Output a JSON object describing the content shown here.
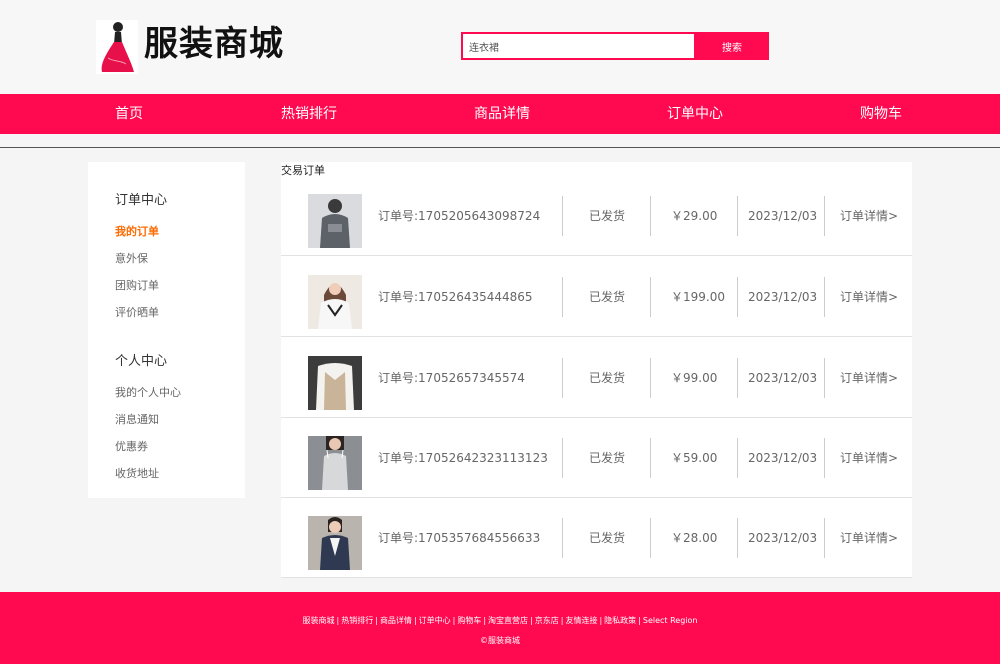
{
  "header": {
    "logo_text": "服装商城",
    "search_value": "连衣裙",
    "search_button": "搜索"
  },
  "nav": {
    "items": [
      "首页",
      "热销排行",
      "商品详情",
      "订单中心",
      "购物车"
    ]
  },
  "sidebar": {
    "section1_title": "订单中心",
    "section1_items": [
      "我的订单",
      "意外保",
      "团购订单",
      "评价晒单"
    ],
    "section2_title": "个人中心",
    "section2_items": [
      "我的个人中心",
      "消息通知",
      "优惠券",
      "收货地址"
    ]
  },
  "orders": {
    "title": "交易订单",
    "rows": [
      {
        "order_no": "订单号:1705205643098724",
        "status": "已发货",
        "price": "￥29.00",
        "date": "2023/12/03",
        "detail": "订单详情>"
      },
      {
        "order_no": "订单号:170526435444865",
        "status": "已发货",
        "price": "￥199.00",
        "date": "2023/12/03",
        "detail": "订单详情>"
      },
      {
        "order_no": "订单号:17052657345574",
        "status": "已发货",
        "price": "￥99.00",
        "date": "2023/12/03",
        "detail": "订单详情>"
      },
      {
        "order_no": "订单号:17052642323113123",
        "status": "已发货",
        "price": "￥59.00",
        "date": "2023/12/03",
        "detail": "订单详情>"
      },
      {
        "order_no": "订单号:1705357684556633",
        "status": "已发货",
        "price": "￥28.00",
        "date": "2023/12/03",
        "detail": "订单详情>"
      }
    ]
  },
  "footer": {
    "links": [
      "服装商城",
      "热销排行",
      "商品详情",
      "订单中心",
      "购物车",
      "淘宝直营店",
      "京东店",
      "友情连接",
      "隐私政策",
      "Select Region"
    ],
    "copyright": "©服装商城"
  },
  "colors": {
    "brand": "#ff0a50",
    "active_link": "#ff6a00"
  }
}
